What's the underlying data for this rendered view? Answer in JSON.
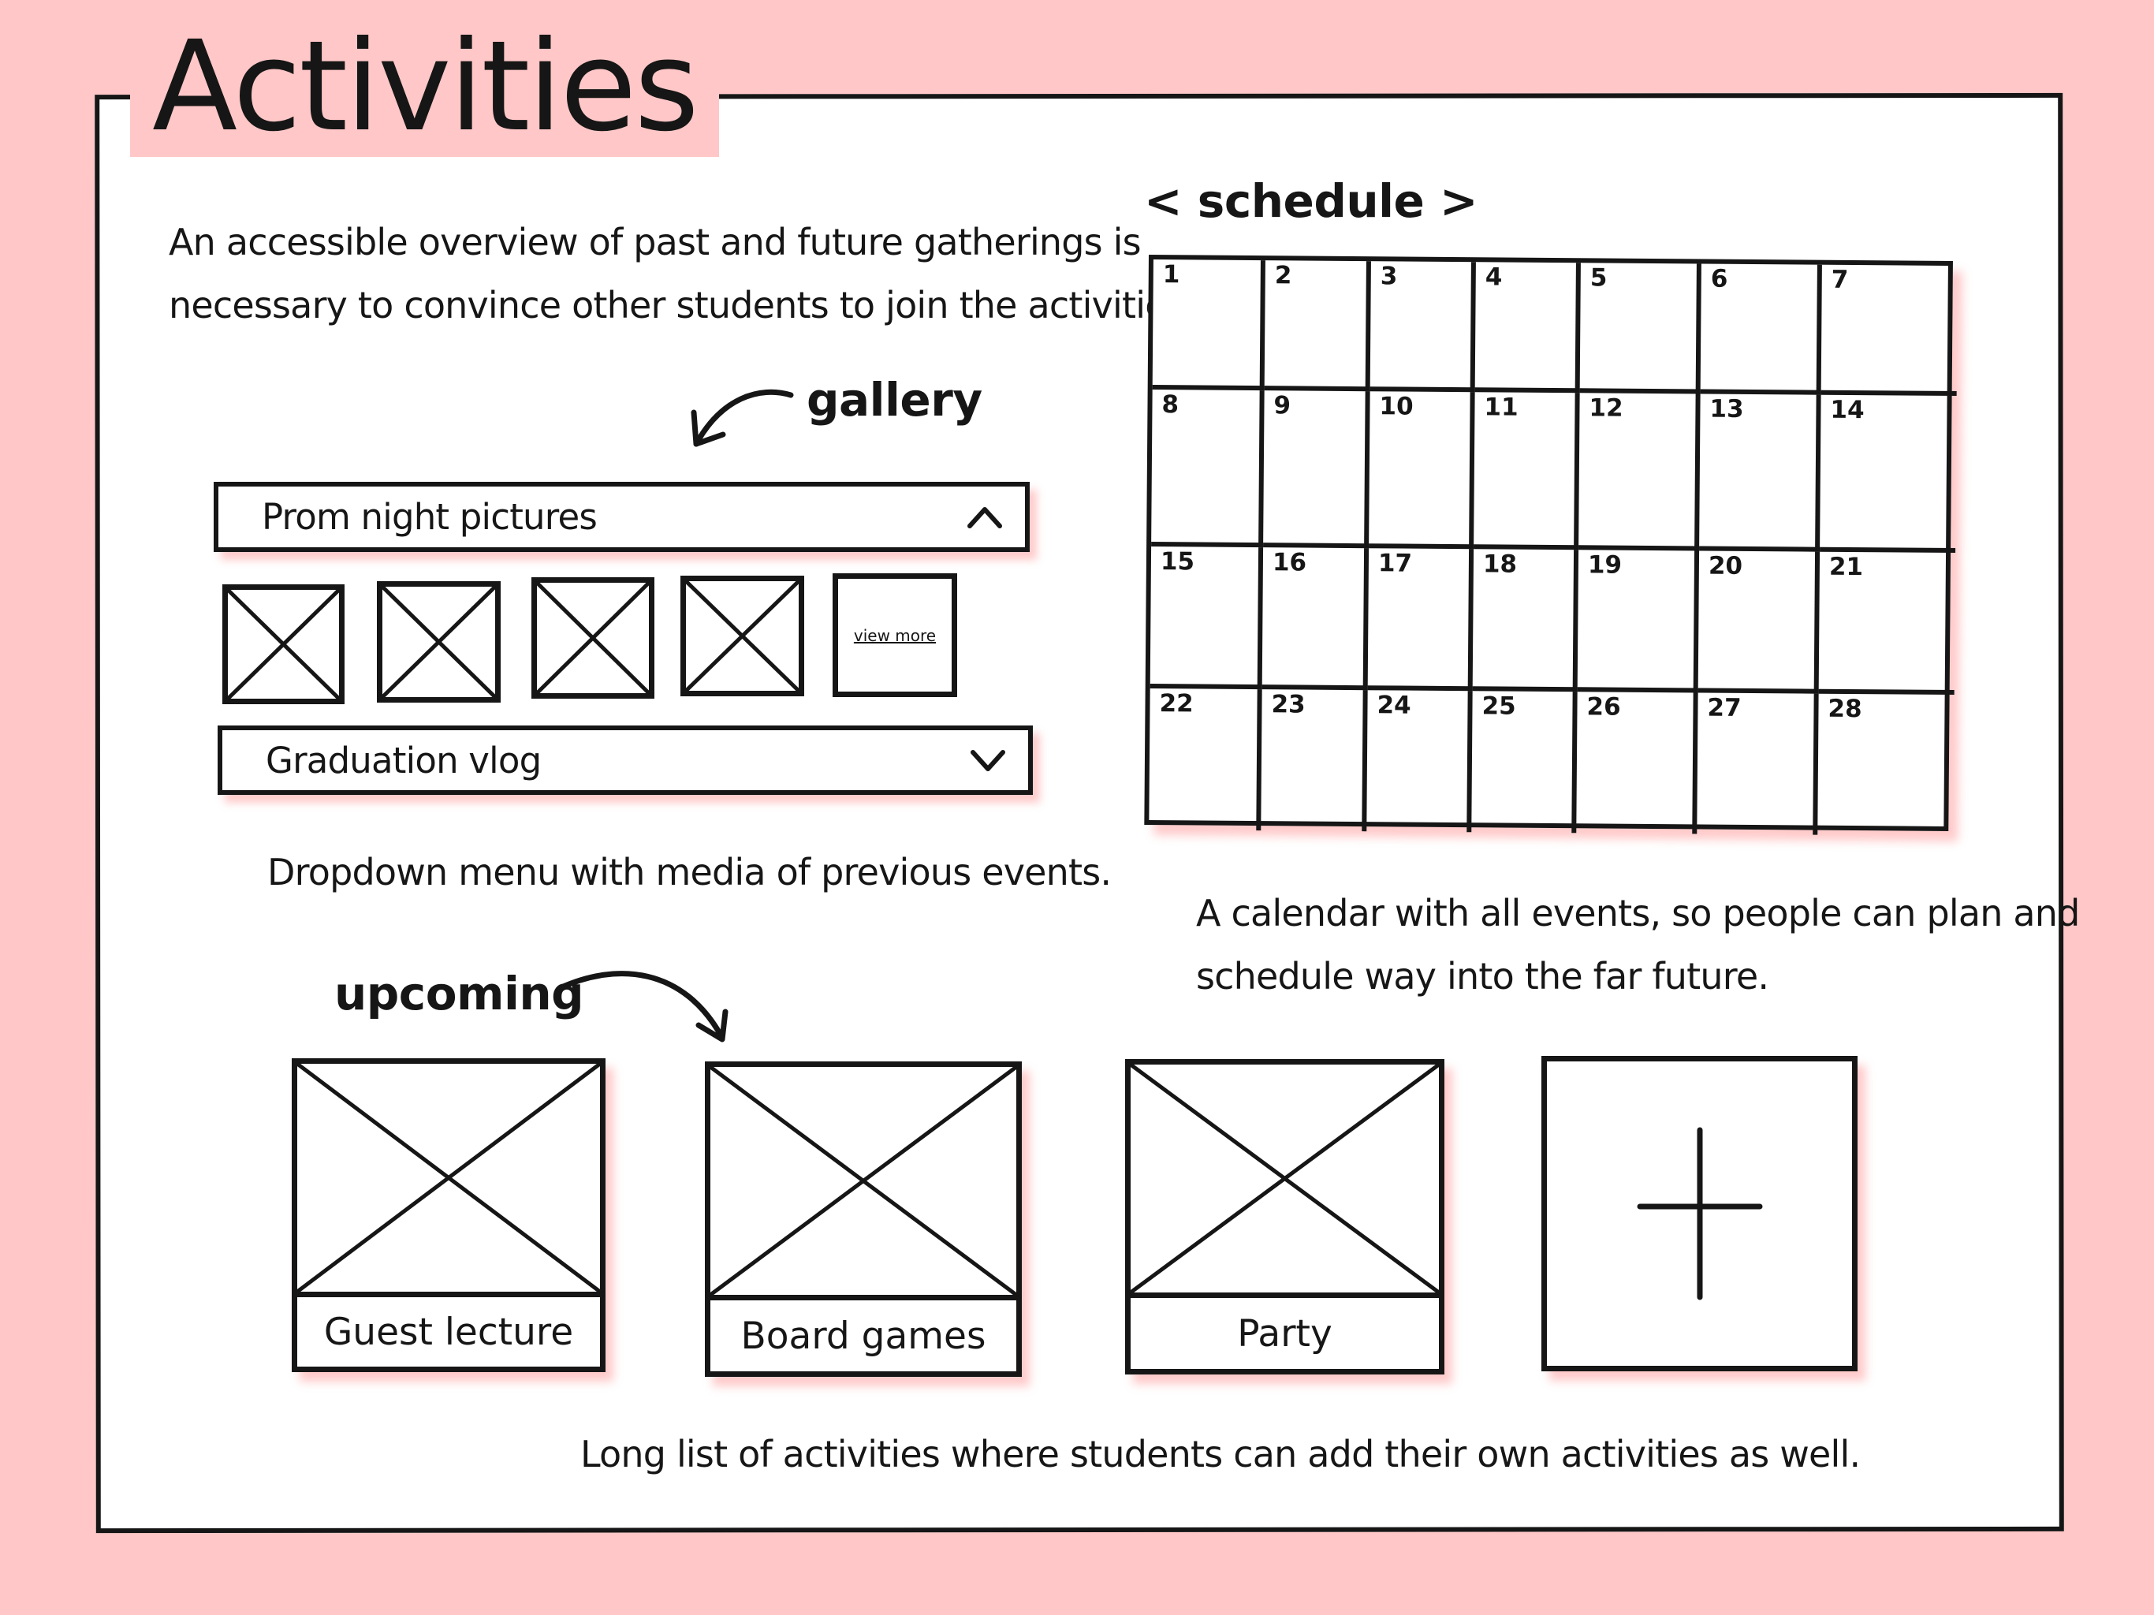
{
  "page": {
    "title": "Activities",
    "intro_line_1": "An accessible overview of past and future gatherings is",
    "intro_line_2": "necessary to convince other students to join the activities."
  },
  "gallery": {
    "label": "gallery",
    "dropdowns": [
      {
        "label": "Prom night pictures",
        "state": "expanded",
        "icon": "chevron-up-icon"
      },
      {
        "label": "Graduation vlog",
        "state": "collapsed",
        "icon": "chevron-down-icon"
      }
    ],
    "thumbnails": [
      {
        "icon": "image-placeholder-icon"
      },
      {
        "icon": "image-placeholder-icon"
      },
      {
        "icon": "image-placeholder-icon"
      },
      {
        "icon": "image-placeholder-icon"
      }
    ],
    "view_more": "view more",
    "caption": "Dropdown menu with media of previous events."
  },
  "schedule": {
    "label": "< schedule >",
    "days": [
      "1",
      "2",
      "3",
      "4",
      "5",
      "6",
      "7",
      "8",
      "9",
      "10",
      "11",
      "12",
      "13",
      "14",
      "15",
      "16",
      "17",
      "18",
      "19",
      "20",
      "21",
      "22",
      "23",
      "24",
      "25",
      "26",
      "27",
      "28"
    ],
    "caption_line_1": "A calendar with all events, so people can plan and",
    "caption_line_2": "schedule way into the far future."
  },
  "upcoming": {
    "label": "upcoming",
    "cards": [
      {
        "title": "Guest lecture",
        "icon": "image-placeholder-icon"
      },
      {
        "title": "Board games",
        "icon": "image-placeholder-icon"
      },
      {
        "title": "Party",
        "icon": "image-placeholder-icon"
      }
    ],
    "add_icon": "plus-icon",
    "caption": "Long list of activities where students can add their own activities as well."
  },
  "colors": {
    "background": "#ffc7c7",
    "panel": "#ffffff",
    "ink": "#161616",
    "shadow": "#ff7474"
  }
}
